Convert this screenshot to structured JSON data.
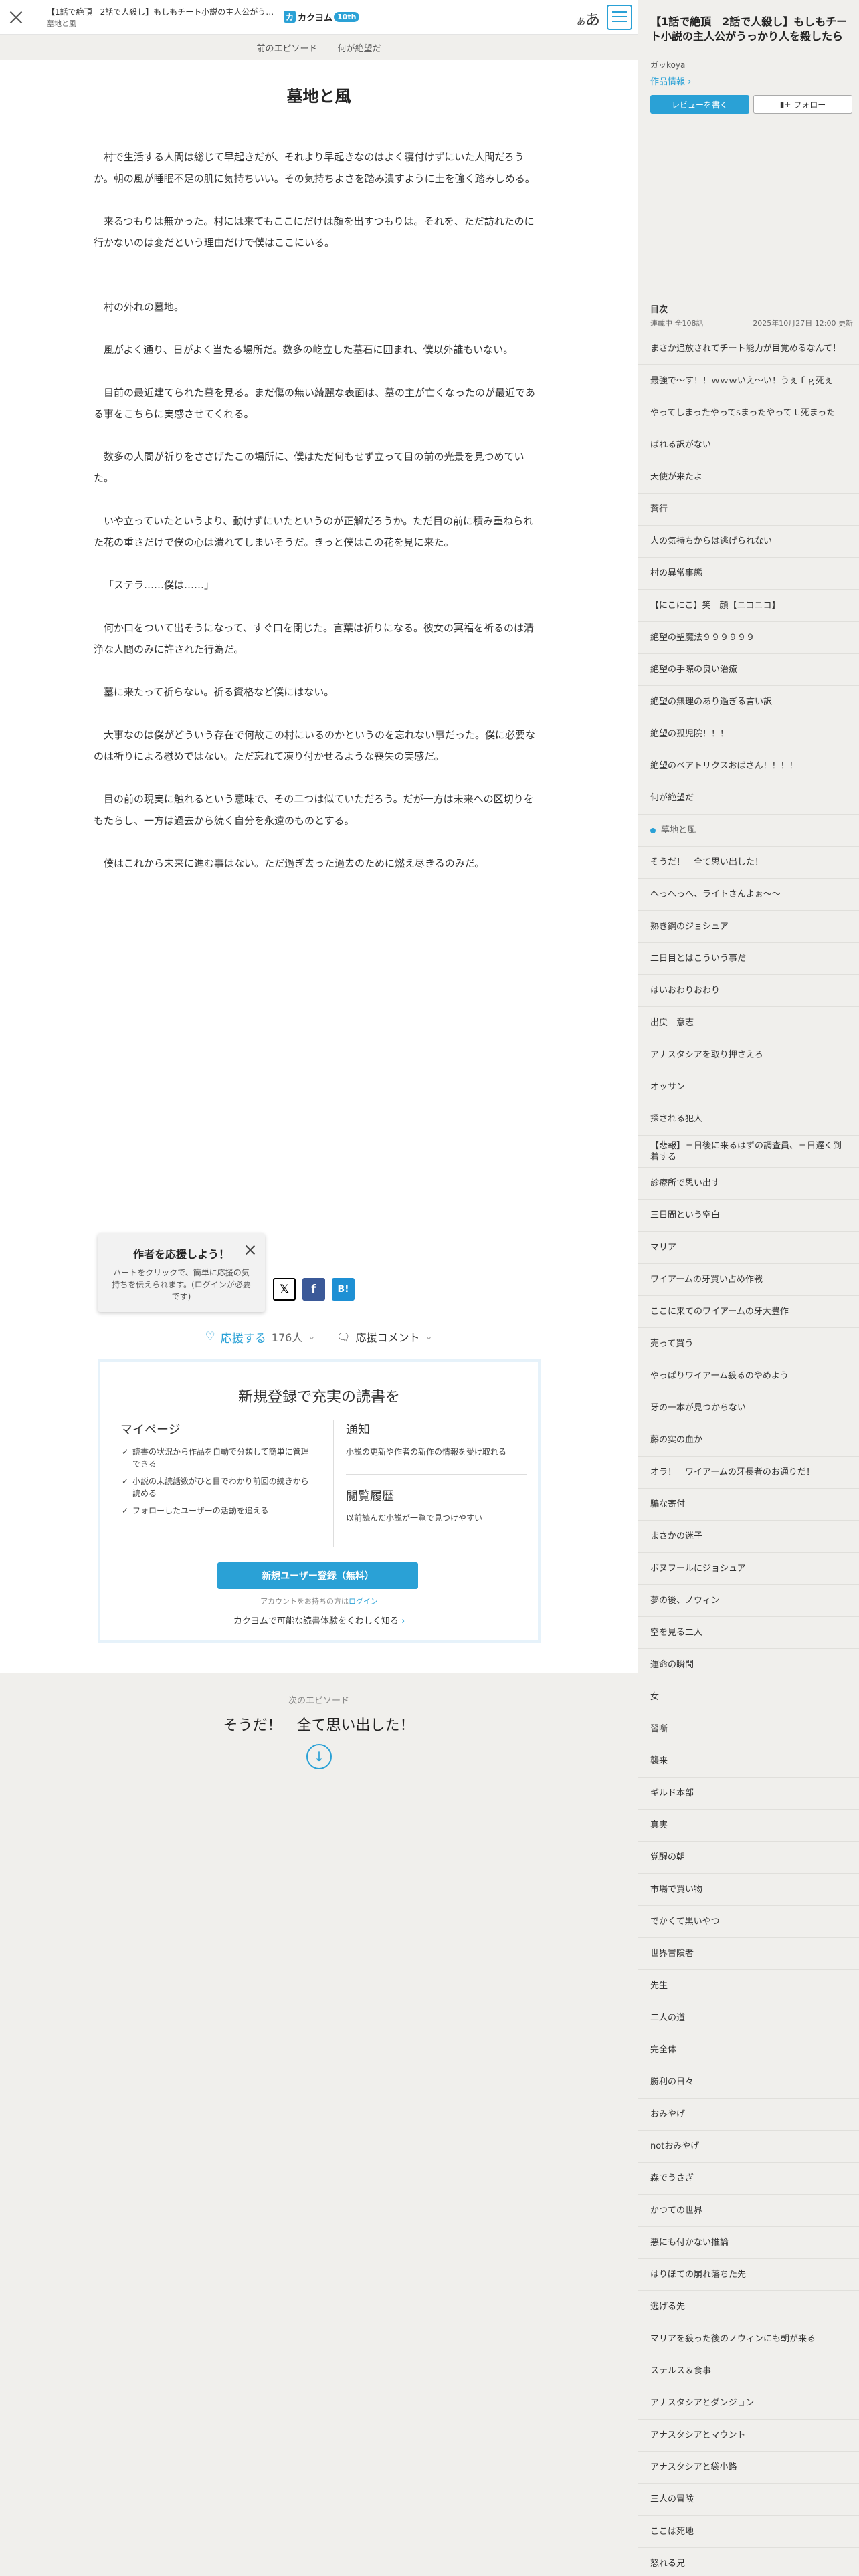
{
  "header": {
    "title": "【1話で絶頂　2話で人殺し】もしもチート小説の主人公がう…",
    "subtitle": "墓地と風",
    "logo_text": "カクヨム",
    "logo_badge": "10th",
    "font_button": "あ",
    "font_button_small": "あ"
  },
  "episode_nav": {
    "prev": "前のエピソード",
    "current": "何が絶望だ"
  },
  "episode": {
    "title": "墓地と風",
    "paragraphs": [
      "村で生活する人間は総じて早起きだが、それより早起きなのはよく寝付けずにいた人間だろうか。朝の風が睡眠不足の肌に気持ちいい。その気持ちよさを踏み潰すように土を強く踏みしめる。",
      "",
      "来るつもりは無かった。村には来てもここにだけは顔を出すつもりは。それを、ただ訪れたのに行かないのは変だという理由だけで僕はここにいる。",
      "",
      "",
      "村の外れの墓地。",
      "",
      "風がよく通り、日がよく当たる場所だ。数多の屹立した墓石に囲まれ、僕以外誰もいない。",
      "",
      "目前の最近建てられた墓を見る。まだ傷の無い綺麗な表面は、墓の主が亡くなったのが最近である事をこちらに実感させてくれる。",
      "",
      "数多の人間が祈りをささげたこの場所に、僕はただ何もせず立って目の前の光景を見つめていた。",
      "",
      "いや立っていたというより、動けずにいたというのが正解だろうか。ただ目の前に積み重ねられた花の重さだけで僕の心は潰れてしまいそうだ。きっと僕はこの花を見に来た。",
      "",
      "「ステラ……僕は……」",
      "",
      "何か口をついて出そうになって、すぐ口を閉じた。言葉は祈りになる。彼女の冥福を祈るのは清浄な人間のみに許された行為だ。",
      "",
      "墓に来たって祈らない。祈る資格など僕にはない。",
      "",
      "大事なのは僕がどういう存在で何故この村にいるのかというのを忘れない事だった。僕に必要なのは祈りによる慰めではない。ただ忘れて凍り付かせるような喪失の実感だ。",
      "",
      "目の前の現実に触れるという意味で、その二つは似ていただろう。だが一方は未来への区切りをもたらし、一方は過去から続く自分を永遠のものとする。",
      "",
      "僕はこれから未来に進む事はない。ただ過ぎ去った過去のために燃え尽きるのみだ。"
    ]
  },
  "cheer_popup": {
    "title": "作者を応援しよう！",
    "text": "ハートをクリックで、簡単に応援の気持ちを伝えられます。(ログインが必要です)"
  },
  "share": {
    "x": "𝕏",
    "facebook": "f",
    "hatena": "B!"
  },
  "cheer": {
    "label": "応援する",
    "count": "176人",
    "comment": "応援コメント"
  },
  "register": {
    "title": "新規登録で充実の読書を",
    "mypage_heading": "マイページ",
    "mypage_items": [
      "読書の状況から作品を自動で分類して簡単に管理できる",
      "小説の未読話数がひと目でわかり前回の続きから読める",
      "フォローしたユーザーの活動を追える"
    ],
    "notify_heading": "通知",
    "notify_desc": "小説の更新や作者の新作の情報を受け取れる",
    "history_heading": "閲覧履歴",
    "history_desc": "以前読んだ小説が一覧で見つけやすい",
    "button": "新規ユーザー登録（無料）",
    "login_prefix": "アカウントをお持ちの方は",
    "login_link": "ログイン",
    "more": "カクヨムで可能な読書体験をくわしく知る"
  },
  "next_episode": {
    "label": "次のエピソード",
    "title": "そうだ！　全て思い出した！"
  },
  "sidebar": {
    "title": "【1話で絶頂　2話で人殺し】もしもチート小説の主人公がうっかり人を殺したら",
    "author": "ガッkoya",
    "info_link": "作品情報",
    "review_button": "レビューを書く",
    "follow_button": "フォロー",
    "toc_heading": "目次",
    "toc_count": "連載中 全108話",
    "toc_updated": "2025年10月27日 12:00 更新",
    "toc": [
      "まさか追放されてチート能力が目覚めるなんて！",
      "最強で～す！！ｗｗｗいえ～い！うぇｆｇ死ぇ",
      "やってしまったやってsまったやってｔ死まった",
      "ばれる訳がない",
      "天使が来たよ",
      "蒼行",
      "人の気持ちからは逃げられない",
      "村の異常事態",
      "【にこにこ】笑　顔【ニコニコ】",
      "絶望の聖魔法９９９９９９",
      "絶望の手際の良い治療",
      "絶望の無理のあり過ぎる言い訳",
      "絶望の孤児院！！！",
      "絶望のベアトリクスおばさん！！！！",
      "何が絶望だ",
      "墓地と風",
      "そうだ！　全て思い出した！",
      "ヘっへっへ、ライトさんよぉ～～",
      "熟き鋼のジョシュア",
      "二日目とはこういう事だ",
      "はいおわりおわり",
      "出戻＝意志",
      "アナスタシアを取り押さえろ",
      "オッサン",
      "探される犯人",
      "【悲報】三日後に来るはずの調査員、三日遅く到着する",
      "診療所で思い出す",
      "三日間という空白",
      "マリア",
      "ワイアームの牙買い占め作戦",
      "ここに来てのワイアームの牙大豊作",
      "売って買う",
      "やっぱりワイアーム殺るのやめよう",
      "牙の一本が見つからない",
      "藤の实の血か",
      "オラ！　ワイアームの牙長者のお通りだ！",
      "騙な寄付",
      "まさかの迷子",
      "ボヌフールにジョシュア",
      "夢の後、ノウィン",
      "空を見る二人",
      "運命の瞬間",
      "女",
      "習噺",
      "襲来",
      "ギルド本部",
      "真実",
      "覚醒の朝",
      "市場で買い物",
      "でかくて黒いやつ",
      "世界冒険者",
      "先生",
      "二人の道",
      "完全体",
      "勝利の日々",
      "おみやげ",
      "notおみやげ",
      "森でうさぎ",
      "かつての世界",
      "悪にも付かない推論",
      "はりぼての崩れ落ちた先",
      "逃げる先",
      "マリアを殺った後のノウィンにも朝が来る",
      "ステルス＆食事",
      "アナスタシアとダンジョン",
      "アナスタシアとマウント",
      "アナスタシアと袋小路",
      "三人の冒険",
      "ここは死地",
      "怒れる兄"
    ],
    "current_index": 15,
    "accent_color": "#2aa1d6"
  }
}
